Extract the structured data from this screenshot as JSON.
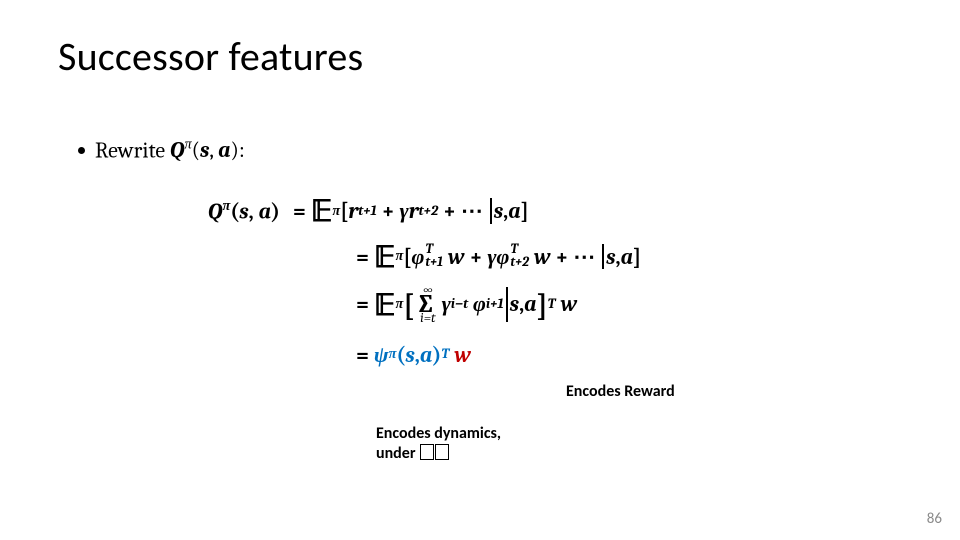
{
  "title": "Successor features",
  "bullet": {
    "rewrite_label": "Rewrite",
    "q_symbol": "Q",
    "q_super": "π",
    "args": "(s, a):"
  },
  "equations": {
    "lhs": "Qπ(s, a)",
    "line1_rhs": "𝔼π[ rt+1 + γ rt+2 + ⋯ | s, a ]",
    "line2_rhs": "𝔼π[ φᵀt+1 w + γ φᵀt+2 w + ⋯ | s, a ]",
    "line3_rhs": "𝔼π[ Σ_{i=t}^{∞} γ^{i−t} φ_{i+1} | s, a ]ᵀ w",
    "line4_rhs": "ψπ(s, a)ᵀ w",
    "psi": "ψ",
    "w": "w"
  },
  "annotations": {
    "reward": "Encodes Reward",
    "dynamics_l1": "Encodes dynamics,",
    "dynamics_l2_prefix": "under "
  },
  "page_number": "86"
}
